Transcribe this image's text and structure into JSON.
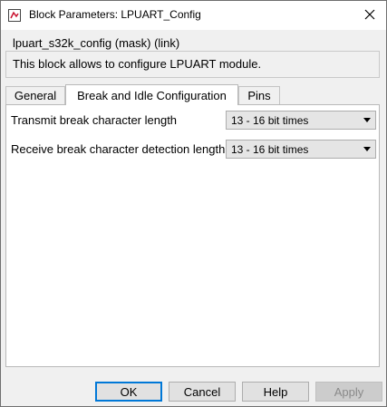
{
  "window": {
    "title": "Block Parameters: LPUART_Config"
  },
  "mask": {
    "heading": "lpuart_s32k_config (mask) (link)",
    "description": "This block allows to configure LPUART module."
  },
  "tabs": [
    {
      "label": "General",
      "active": false
    },
    {
      "label": "Break and Idle Configuration",
      "active": true
    },
    {
      "label": "Pins",
      "active": false
    }
  ],
  "params": [
    {
      "label": "Transmit break character length",
      "value": "13 - 16 bit times"
    },
    {
      "label": "Receive break character detection length",
      "value": "13 - 16 bit times"
    }
  ],
  "buttons": {
    "ok": "OK",
    "cancel": "Cancel",
    "help": "Help",
    "apply": "Apply"
  },
  "colors": {
    "accent": "#0078d7",
    "icon_red": "#c8102e"
  },
  "icons": {
    "title": "simulink-block-icon",
    "close": "close-icon",
    "dropdown": "chevron-down-icon"
  }
}
